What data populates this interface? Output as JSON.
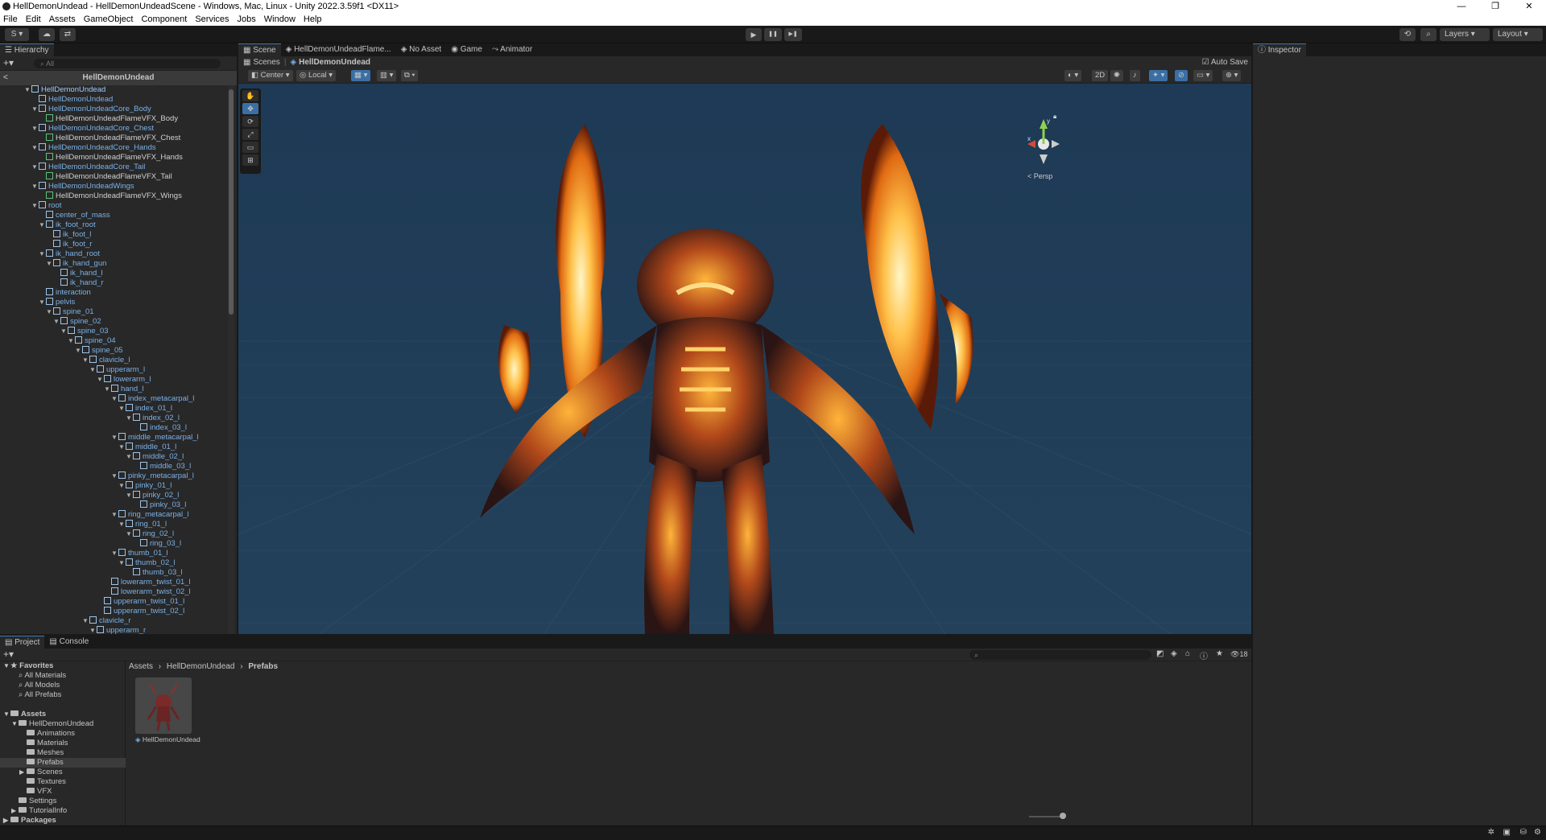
{
  "window": {
    "title": "HellDemonUndead - HellDemonUndeadScene - Windows, Mac, Linux - Unity 2022.3.59f1 <DX11>",
    "controls": [
      "—",
      "❐",
      "✕"
    ]
  },
  "menu": [
    "File",
    "Edit",
    "Assets",
    "GameObject",
    "Component",
    "Services",
    "Jobs",
    "Window",
    "Help"
  ],
  "toolbar": {
    "account": "S ▾",
    "play_icon": "▶",
    "pause_icon": "❚❚",
    "step_icon": "▶❚",
    "layers": "Layers",
    "layout": "Layout"
  },
  "hierarchy": {
    "tab": "Hierarchy",
    "search_placeholder": "All",
    "header": "HellDemonUndead",
    "rows": [
      {
        "label": "HellDemonUndead",
        "depth": 0,
        "arrow": "▼",
        "type": "prefab"
      },
      {
        "label": "HellDemonUndead",
        "depth": 1,
        "arrow": "",
        "type": "prefab"
      },
      {
        "label": "HellDemonUndeadCore_Body",
        "depth": 1,
        "arrow": "▼",
        "type": "prefab"
      },
      {
        "label": "HellDemonUndeadFlameVFX_Body",
        "depth": 2,
        "arrow": "",
        "type": "vfx"
      },
      {
        "label": "HellDemonUndeadCore_Chest",
        "depth": 1,
        "arrow": "▼",
        "type": "prefab"
      },
      {
        "label": "HellDemonUndeadFlameVFX_Chest",
        "depth": 2,
        "arrow": "",
        "type": "vfx"
      },
      {
        "label": "HellDemonUndeadCore_Hands",
        "depth": 1,
        "arrow": "▼",
        "type": "prefab"
      },
      {
        "label": "HellDemonUndeadFlameVFX_Hands",
        "depth": 2,
        "arrow": "",
        "type": "vfx"
      },
      {
        "label": "HellDemonUndeadCore_Tail",
        "depth": 1,
        "arrow": "▼",
        "type": "prefab"
      },
      {
        "label": "HellDemonUndeadFlameVFX_Tail",
        "depth": 2,
        "arrow": "",
        "type": "vfx"
      },
      {
        "label": "HellDemonUndeadWings",
        "depth": 1,
        "arrow": "▼",
        "type": "prefab"
      },
      {
        "label": "HellDemonUndeadFlameVFX_Wings",
        "depth": 2,
        "arrow": "",
        "type": "vfx"
      },
      {
        "label": "root",
        "depth": 1,
        "arrow": "▼",
        "type": "prefab"
      },
      {
        "label": "center_of_mass",
        "depth": 2,
        "arrow": "",
        "type": "prefab"
      },
      {
        "label": "ik_foot_root",
        "depth": 2,
        "arrow": "▼",
        "type": "prefab"
      },
      {
        "label": "ik_foot_l",
        "depth": 3,
        "arrow": "",
        "type": "prefab"
      },
      {
        "label": "ik_foot_r",
        "depth": 3,
        "arrow": "",
        "type": "prefab"
      },
      {
        "label": "ik_hand_root",
        "depth": 2,
        "arrow": "▼",
        "type": "prefab"
      },
      {
        "label": "ik_hand_gun",
        "depth": 3,
        "arrow": "▼",
        "type": "prefab"
      },
      {
        "label": "ik_hand_l",
        "depth": 4,
        "arrow": "",
        "type": "prefab"
      },
      {
        "label": "ik_hand_r",
        "depth": 4,
        "arrow": "",
        "type": "prefab"
      },
      {
        "label": "interaction",
        "depth": 2,
        "arrow": "",
        "type": "prefab"
      },
      {
        "label": "pelvis",
        "depth": 2,
        "arrow": "▼",
        "type": "prefab"
      },
      {
        "label": "spine_01",
        "depth": 3,
        "arrow": "▼",
        "type": "prefab"
      },
      {
        "label": "spine_02",
        "depth": 4,
        "arrow": "▼",
        "type": "prefab"
      },
      {
        "label": "spine_03",
        "depth": 5,
        "arrow": "▼",
        "type": "prefab"
      },
      {
        "label": "spine_04",
        "depth": 6,
        "arrow": "▼",
        "type": "prefab"
      },
      {
        "label": "spine_05",
        "depth": 7,
        "arrow": "▼",
        "type": "prefab"
      },
      {
        "label": "clavicle_l",
        "depth": 8,
        "arrow": "▼",
        "type": "prefab"
      },
      {
        "label": "upperarm_l",
        "depth": 9,
        "arrow": "▼",
        "type": "prefab"
      },
      {
        "label": "lowerarm_l",
        "depth": 10,
        "arrow": "▼",
        "type": "prefab"
      },
      {
        "label": "hand_l",
        "depth": 11,
        "arrow": "▼",
        "type": "prefab"
      },
      {
        "label": "index_metacarpal_l",
        "depth": 12,
        "arrow": "▼",
        "type": "prefab"
      },
      {
        "label": "index_01_l",
        "depth": 13,
        "arrow": "▼",
        "type": "prefab"
      },
      {
        "label": "index_02_l",
        "depth": 14,
        "arrow": "▼",
        "type": "prefab"
      },
      {
        "label": "index_03_l",
        "depth": 15,
        "arrow": "",
        "type": "prefab"
      },
      {
        "label": "middle_metacarpal_l",
        "depth": 12,
        "arrow": "▼",
        "type": "prefab"
      },
      {
        "label": "middle_01_l",
        "depth": 13,
        "arrow": "▼",
        "type": "prefab"
      },
      {
        "label": "middle_02_l",
        "depth": 14,
        "arrow": "▼",
        "type": "prefab"
      },
      {
        "label": "middle_03_l",
        "depth": 15,
        "arrow": "",
        "type": "prefab"
      },
      {
        "label": "pinky_metacarpal_l",
        "depth": 12,
        "arrow": "▼",
        "type": "prefab"
      },
      {
        "label": "pinky_01_l",
        "depth": 13,
        "arrow": "▼",
        "type": "prefab"
      },
      {
        "label": "pinky_02_l",
        "depth": 14,
        "arrow": "▼",
        "type": "prefab"
      },
      {
        "label": "pinky_03_l",
        "depth": 15,
        "arrow": "",
        "type": "prefab"
      },
      {
        "label": "ring_metacarpal_l",
        "depth": 12,
        "arrow": "▼",
        "type": "prefab"
      },
      {
        "label": "ring_01_l",
        "depth": 13,
        "arrow": "▼",
        "type": "prefab"
      },
      {
        "label": "ring_02_l",
        "depth": 14,
        "arrow": "▼",
        "type": "prefab"
      },
      {
        "label": "ring_03_l",
        "depth": 15,
        "arrow": "",
        "type": "prefab"
      },
      {
        "label": "thumb_01_l",
        "depth": 12,
        "arrow": "▼",
        "type": "prefab"
      },
      {
        "label": "thumb_02_l",
        "depth": 13,
        "arrow": "▼",
        "type": "prefab"
      },
      {
        "label": "thumb_03_l",
        "depth": 14,
        "arrow": "",
        "type": "prefab"
      },
      {
        "label": "lowerarm_twist_01_l",
        "depth": 11,
        "arrow": "",
        "type": "prefab"
      },
      {
        "label": "lowerarm_twist_02_l",
        "depth": 11,
        "arrow": "",
        "type": "prefab"
      },
      {
        "label": "upperarm_twist_01_l",
        "depth": 10,
        "arrow": "",
        "type": "prefab"
      },
      {
        "label": "upperarm_twist_02_l",
        "depth": 10,
        "arrow": "",
        "type": "prefab"
      },
      {
        "label": "clavicle_r",
        "depth": 8,
        "arrow": "▼",
        "type": "prefab"
      },
      {
        "label": "upperarm_r",
        "depth": 9,
        "arrow": "▼",
        "type": "prefab"
      }
    ]
  },
  "scene": {
    "tabs": [
      "Scene",
      "HellDemonUndeadFlame...",
      "No Asset",
      "Game",
      "Animator"
    ],
    "breadcrumb": [
      "Scenes",
      "HellDemonUndead"
    ],
    "auto_save": "Auto Save",
    "pivot": "Center",
    "space": "Local",
    "mode_2d": "2D",
    "gizmo_persp": "< Persp",
    "gizmo_x": "x",
    "gizmo_y": "y"
  },
  "inspector": {
    "tab": "Inspector"
  },
  "project": {
    "tabs": [
      "Project",
      "Console"
    ],
    "count": "18",
    "breadcrumb": [
      "Assets",
      "HellDemonUndead",
      "Prefabs"
    ],
    "tree": [
      {
        "label": "Favorites",
        "depth": 0,
        "arrow": "▼",
        "bold": true,
        "icon": "star"
      },
      {
        "label": "All Materials",
        "depth": 1,
        "arrow": "",
        "bold": false,
        "icon": "search"
      },
      {
        "label": "All Models",
        "depth": 1,
        "arrow": "",
        "bold": false,
        "icon": "search"
      },
      {
        "label": "All Prefabs",
        "depth": 1,
        "arrow": "",
        "bold": false,
        "icon": "search"
      },
      {
        "label": "",
        "depth": 0,
        "arrow": "",
        "bold": false,
        "icon": ""
      },
      {
        "label": "Assets",
        "depth": 0,
        "arrow": "▼",
        "bold": true,
        "icon": "folder"
      },
      {
        "label": "HellDemonUndead",
        "depth": 1,
        "arrow": "▼",
        "bold": false,
        "icon": "folder"
      },
      {
        "label": "Animations",
        "depth": 2,
        "arrow": "",
        "bold": false,
        "icon": "folder"
      },
      {
        "label": "Materials",
        "depth": 2,
        "arrow": "",
        "bold": false,
        "icon": "folder"
      },
      {
        "label": "Meshes",
        "depth": 2,
        "arrow": "",
        "bold": false,
        "icon": "folder"
      },
      {
        "label": "Prefabs",
        "depth": 2,
        "arrow": "",
        "bold": false,
        "icon": "folder",
        "selected": true
      },
      {
        "label": "Scenes",
        "depth": 2,
        "arrow": "▶",
        "bold": false,
        "icon": "folder"
      },
      {
        "label": "Textures",
        "depth": 2,
        "arrow": "",
        "bold": false,
        "icon": "folder"
      },
      {
        "label": "VFX",
        "depth": 2,
        "arrow": "",
        "bold": false,
        "icon": "folder"
      },
      {
        "label": "Settings",
        "depth": 1,
        "arrow": "",
        "bold": false,
        "icon": "folder"
      },
      {
        "label": "TutorialInfo",
        "depth": 1,
        "arrow": "▶",
        "bold": false,
        "icon": "folder"
      },
      {
        "label": "Packages",
        "depth": 0,
        "arrow": "▶",
        "bold": true,
        "icon": "folder"
      }
    ],
    "asset": {
      "name": "HellDemonUndead"
    }
  }
}
